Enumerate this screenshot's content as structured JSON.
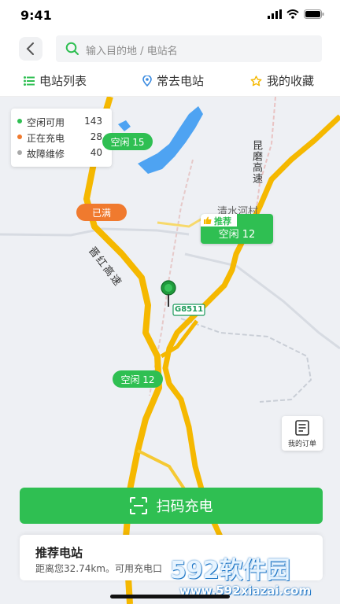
{
  "status_bar": {
    "time": "9:41"
  },
  "search": {
    "placeholder": "输入目的地 / 电站名"
  },
  "tabs": [
    {
      "label": "电站列表",
      "icon": "list-icon"
    },
    {
      "label": "常去电站",
      "icon": "location-pin-icon"
    },
    {
      "label": "我的收藏",
      "icon": "star-icon"
    }
  ],
  "legend": [
    {
      "label": "空闲可用",
      "count": "143",
      "color": "#2fbf52"
    },
    {
      "label": "正在充电",
      "count": "28",
      "color": "#f07a2e"
    },
    {
      "label": "故障维修",
      "count": "40",
      "color": "#a8a8a8"
    }
  ],
  "markers": [
    {
      "label": "空闲 15",
      "status": "free"
    },
    {
      "label": "已满",
      "status": "full"
    },
    {
      "label": "空闲 12",
      "status": "free"
    }
  ],
  "recommended_marker": {
    "tag": "推荐",
    "label": "空闲 12"
  },
  "map_labels": {
    "road_sign": "G8511",
    "road_jinhong": "晋红高速",
    "road_kunmo": "昆磨高速",
    "village": "清水河村"
  },
  "orders_button": {
    "label": "我的订单"
  },
  "scan_button": {
    "label": "扫码充电"
  },
  "recommend_panel": {
    "title": "推荐电站",
    "description": "距离您32.74km。可用充电口"
  },
  "watermark": {
    "brand": "592软件园",
    "url": "www.592xiazai.com"
  },
  "colors": {
    "primary": "#2fbf52",
    "full": "#f07a2e",
    "road": "#f5b800"
  }
}
